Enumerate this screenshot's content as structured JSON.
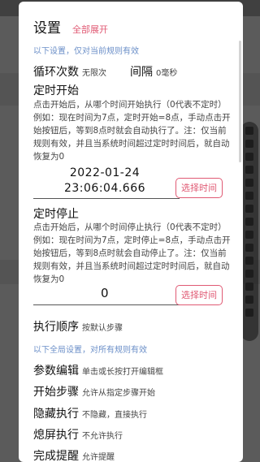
{
  "dialog": {
    "title": "设置",
    "expand_all": "全部展开",
    "note_current": "以下设置，仅对当前规则有效",
    "loop": {
      "label": "循环次数",
      "value": "无限次"
    },
    "interval": {
      "label": "间隔",
      "value": "0毫秒"
    },
    "timed_start": {
      "label": "定时开始",
      "desc": "点击开始后，从哪个时间开始执行（0代表不定时）例如：现在时间为7点，定时开始=8点，手动点击开始按钮后，等到8点时就会自动执行了。注：仅当前规则有效，并且当系统时间超过定时时间后，就自动恢复为0",
      "date": "2022-01-24",
      "time": "23:06:04.666",
      "button": "选择时间"
    },
    "timed_stop": {
      "label": "定时停止",
      "desc": "点击开始后，从哪个时间停止执行（0代表不定时）例如：现在时间为7点，定时停止=8点，手动点击开始按钮后，等到8点时就会自动停止了。注：仅当前规则有效，并且当系统时间超过定时时间后，就自动恢复为0",
      "value": "0",
      "button": "选择时间"
    },
    "order": {
      "label": "执行顺序",
      "value": "按默认步骤"
    },
    "note_global": "以下全局设置，对所有规则有效",
    "param_edit": {
      "label": "参数编辑",
      "value": "单击或长按打开编辑框"
    },
    "start_step": {
      "label": "开始步骤",
      "value": "允许从指定步骤开始"
    },
    "hide_exec": {
      "label": "隐藏执行",
      "value": "不隐藏，直接执行"
    },
    "screen_off": {
      "label": "熄屏执行",
      "value": "不允许执行"
    },
    "done_remind": {
      "label": "完成提醒",
      "value": "允许提醒"
    }
  }
}
